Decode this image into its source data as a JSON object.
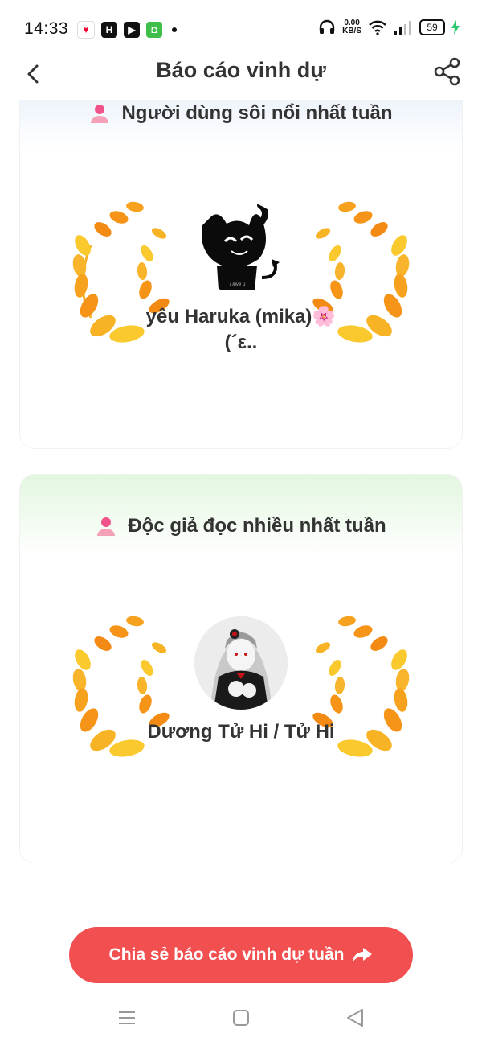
{
  "status_bar": {
    "time": "14:33",
    "speed_value": "0.00",
    "speed_unit": "KB/S",
    "battery": "59"
  },
  "header": {
    "title": "Báo cáo vinh dự"
  },
  "cards": [
    {
      "heading": "Người dùng sôi nổi nhất tuần",
      "username": "yêu Haruka (mika)🌸(´ε..",
      "avatar_caption": "I love u"
    },
    {
      "heading": "Độc giả đọc nhiều nhất tuần",
      "username": "Dương Tử Hi / Tử Hi"
    }
  ],
  "share_button": {
    "label": "Chia sẻ báo cáo vinh dự tuần"
  },
  "colors": {
    "accent": "#f14f50",
    "laurel_light": "#f9c92d",
    "laurel_dark": "#f38a13",
    "person_icon": "#f0528a"
  },
  "icons": {
    "back": "back-arrow-icon",
    "share": "share-icon",
    "person": "person-icon",
    "nav_menu": "menu-icon",
    "nav_home": "home-icon",
    "nav_back": "back-triangle-icon"
  }
}
